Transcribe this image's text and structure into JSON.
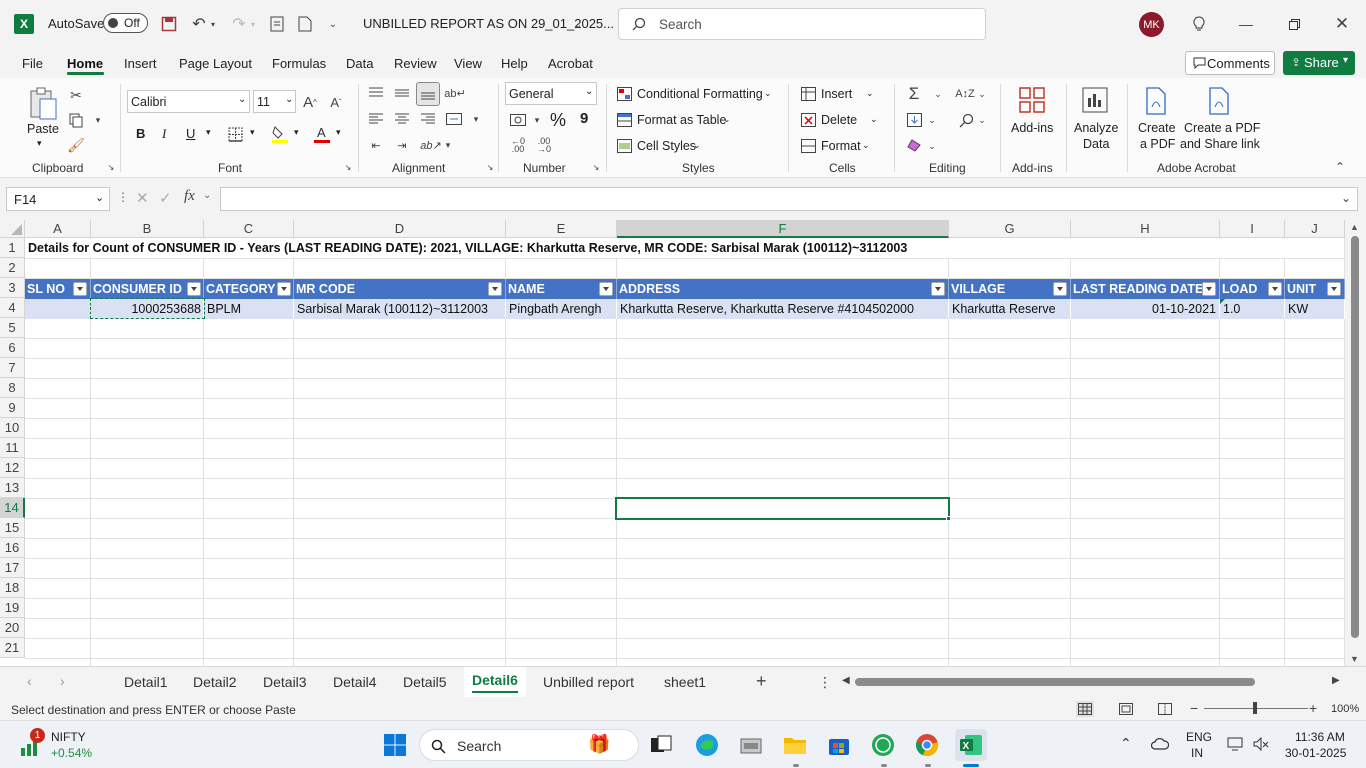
{
  "titlebar": {
    "autosave_label": "AutoSave",
    "autosave_state": "Off",
    "filename": "UNBILLED REPORT AS ON 29_01_2025...",
    "search_placeholder": "Search",
    "user_initials": "MK"
  },
  "menu": [
    "File",
    "Home",
    "Insert",
    "Page Layout",
    "Formulas",
    "Data",
    "Review",
    "View",
    "Help",
    "Acrobat"
  ],
  "menu_right": {
    "comments": "Comments",
    "share": "Share"
  },
  "ribbon": {
    "clipboard": {
      "paste": "Paste",
      "label": "Clipboard"
    },
    "font": {
      "name": "Calibri",
      "size": "11",
      "bold": "B",
      "italic": "I",
      "underline": "U",
      "label": "Font"
    },
    "alignment": {
      "label": "Alignment"
    },
    "number": {
      "format": "General",
      "percent": "%",
      "comma": "9",
      "label": "Number"
    },
    "styles": {
      "conditional": "Conditional Formatting",
      "format_table": "Format as Table",
      "cell_styles": "Cell Styles",
      "label": "Styles"
    },
    "cells": {
      "insert": "Insert",
      "delete": "Delete",
      "format": "Format",
      "label": "Cells"
    },
    "editing": {
      "label": "Editing"
    },
    "addins": {
      "addins": "Add-ins",
      "label": "Add-ins"
    },
    "analyze": {
      "line1": "Analyze",
      "line2": "Data"
    },
    "acrobat": {
      "create1": "Create",
      "create2": "a PDF",
      "share1": "Create a PDF",
      "share2": "and Share link",
      "label": "Adobe Acrobat"
    }
  },
  "formula": {
    "namebox": "F14",
    "fx": "fx"
  },
  "columns": [
    "A",
    "B",
    "C",
    "D",
    "E",
    "F",
    "G",
    "H",
    "I",
    "J"
  ],
  "rows": [
    "1",
    "2",
    "3",
    "4",
    "5",
    "6",
    "7",
    "8",
    "9",
    "10",
    "11",
    "12",
    "13",
    "14",
    "15",
    "16",
    "17",
    "18",
    "19",
    "20",
    "21"
  ],
  "sheet": {
    "title": "Details for Count of CONSUMER ID - Years (LAST READING DATE): 2021, VILLAGE: Kharkutta Reserve, MR CODE: Sarbisal Marak (100112)~3112003",
    "headers": [
      "SL NO",
      "CONSUMER ID",
      "CATEGORY",
      "MR CODE",
      "NAME",
      "ADDRESS",
      "VILLAGE",
      "LAST READING DATE",
      "LOAD",
      "UNIT"
    ],
    "row": {
      "sl_no": "",
      "consumer_id": "1000253688",
      "category": "BPLM",
      "mr_code": "Sarbisal Marak (100112)~3112003",
      "name": "Pingbath Arengh",
      "address": "Kharkutta Reserve, Kharkutta Reserve #4104502000",
      "village": "Kharkutta Reserve",
      "last_reading_date": "01-10-2021",
      "load": "1.0",
      "unit": "KW"
    }
  },
  "tabs": [
    "Detail1",
    "Detail2",
    "Detail3",
    "Detail4",
    "Detail5",
    "Detail6",
    "Unbilled report",
    "sheet1"
  ],
  "active_tab": "Detail6",
  "status": {
    "message": "Select destination and press ENTER or choose Paste",
    "zoom": "100%"
  },
  "taskbar": {
    "nifty": "NIFTY",
    "nifty_change": "+0.54%",
    "badge": "1",
    "search": "Search",
    "lang1": "ENG",
    "lang2": "IN",
    "time": "11:36 AM",
    "date": "30-01-2025"
  },
  "colors": {
    "excel_green": "#217346",
    "table_header": "#4472c4",
    "table_row": "#d9e1f2",
    "selection": "#107c41"
  }
}
